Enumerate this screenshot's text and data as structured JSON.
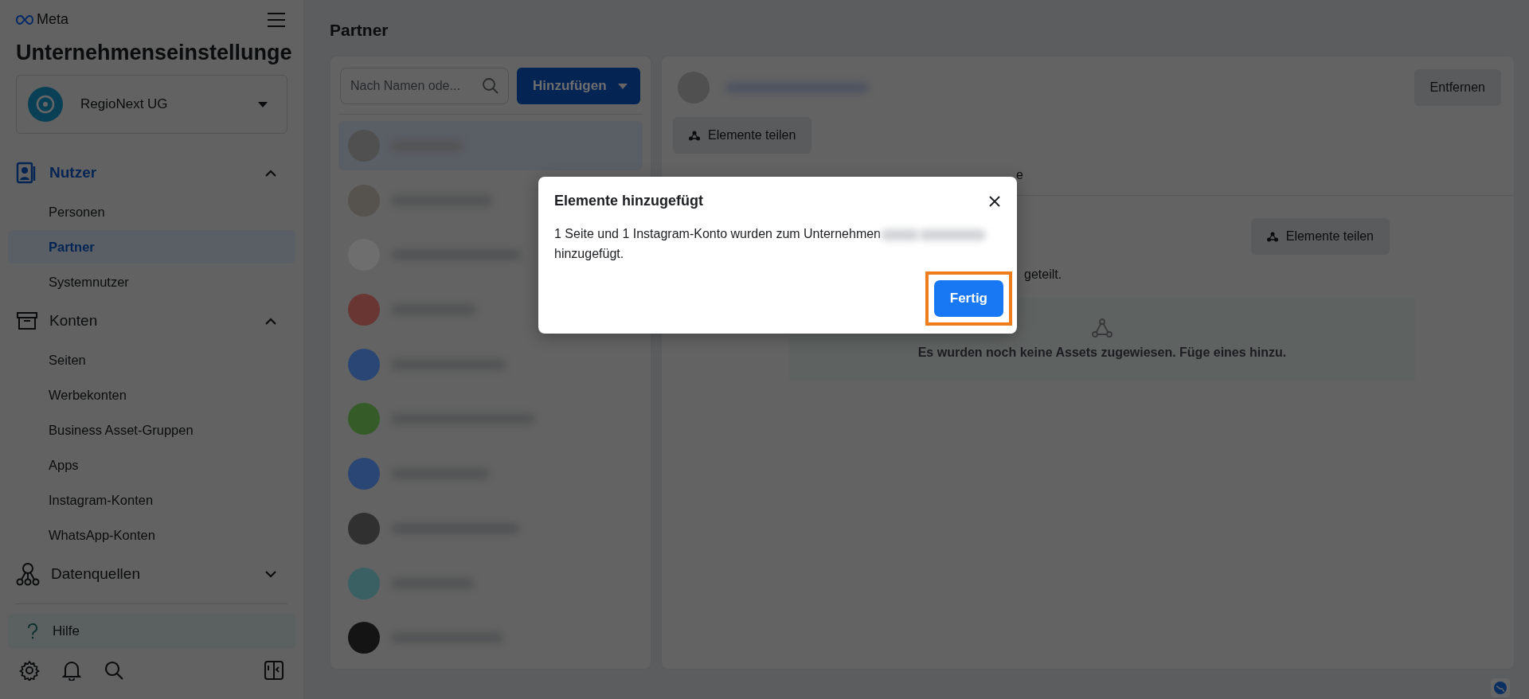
{
  "sidebar": {
    "brand": "Meta",
    "title": "Unternehmenseinstellunge",
    "account": "RegioNext UG",
    "sections": [
      {
        "label": "Nutzer",
        "kind": "users",
        "expanded": true,
        "children": [
          {
            "label": "Personen",
            "selected": false
          },
          {
            "label": "Partner",
            "selected": true
          },
          {
            "label": "Systemnutzer",
            "selected": false
          }
        ]
      },
      {
        "label": "Konten",
        "kind": "accounts",
        "expanded": true,
        "children": [
          {
            "label": "Seiten",
            "selected": false
          },
          {
            "label": "Werbekonten",
            "selected": false
          },
          {
            "label": "Business Asset-Gruppen",
            "selected": false
          },
          {
            "label": "Apps",
            "selected": false
          },
          {
            "label": "Instagram-Konten",
            "selected": false
          },
          {
            "label": "WhatsApp-Konten",
            "selected": false
          }
        ]
      },
      {
        "label": "Datenquellen",
        "kind": "data",
        "expanded": false
      }
    ],
    "help": "Hilfe"
  },
  "page_title": "Partner",
  "partner_list": {
    "search": {
      "placeholder": "Nach Namen ode..."
    },
    "add_button": "Hinzufügen",
    "items": [
      {
        "selected": true,
        "color": "#505050"
      },
      {
        "selected": false,
        "color": "#56534e"
      },
      {
        "selected": false,
        "color": "#6e6e6e"
      },
      {
        "selected": false,
        "color": "#6a3634"
      },
      {
        "selected": false,
        "color": "#2a4675"
      },
      {
        "selected": false,
        "color": "#355c28"
      },
      {
        "selected": false,
        "color": "#2a4675"
      },
      {
        "selected": false,
        "color": "#303030"
      },
      {
        "selected": false,
        "color": "#3a6064"
      },
      {
        "selected": false,
        "color": "#141414"
      }
    ]
  },
  "detail": {
    "remove_button": "Entfernen",
    "share_button": "Elemente teilen",
    "tab_fragment": "e",
    "section_share_button": "Elemente teilen",
    "shared_fragment": "geteilt.",
    "empty_text": "Es wurden noch keine Assets zugewiesen. Füge eines hinzu."
  },
  "dialog": {
    "title": "Elemente hinzugefügt",
    "message_start": "1 Seite und 1 Instagram-Konto wurden zum Unternehmen",
    "message_end": "hinzugefügt.",
    "done_button": "Fertig",
    "highlighted": true
  }
}
